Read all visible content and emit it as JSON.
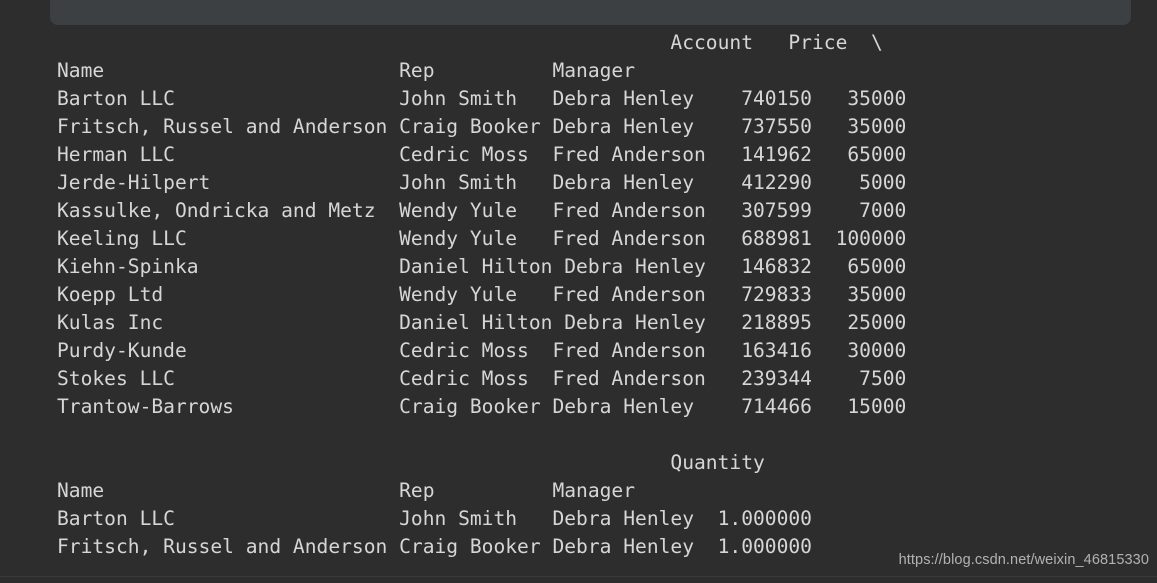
{
  "window": {
    "background_color": "#2d2d2d",
    "cell_background_color": "#3c4043",
    "text_color": "#d6d6d6"
  },
  "watermark": {
    "text": "https://blog.csdn.net/weixin_46815330"
  },
  "output": {
    "type": "pandas-dataframe-text-repr",
    "line_continuation_marker": "\\",
    "blocks": [
      {
        "id": "block-account-price",
        "column_header_line": "                                                    Account   Price  \\",
        "index_header_line": "Name                         Rep          Manager                      ",
        "columns": [
          "Account",
          "Price"
        ],
        "index_names": [
          "Name",
          "Rep",
          "Manager"
        ],
        "rows": [
          {
            "name": "Barton LLC",
            "rep": "John Smith",
            "manager": "Debra Henley",
            "account": "740150",
            "price": "35000"
          },
          {
            "name": "Fritsch, Russel and Anderson",
            "rep": "Craig Booker",
            "manager": "Debra Henley",
            "account": "737550",
            "price": "35000"
          },
          {
            "name": "Herman LLC",
            "rep": "Cedric Moss",
            "manager": "Fred Anderson",
            "account": "141962",
            "price": "65000"
          },
          {
            "name": "Jerde-Hilpert",
            "rep": "John Smith",
            "manager": "Debra Henley",
            "account": "412290",
            "price": "5000"
          },
          {
            "name": "Kassulke, Ondricka and Metz",
            "rep": "Wendy Yule",
            "manager": "Fred Anderson",
            "account": "307599",
            "price": "7000"
          },
          {
            "name": "Keeling LLC",
            "rep": "Wendy Yule",
            "manager": "Fred Anderson",
            "account": "688981",
            "price": "100000"
          },
          {
            "name": "Kiehn-Spinka",
            "rep": "Daniel Hilton",
            "manager": "Debra Henley",
            "account": "146832",
            "price": "65000"
          },
          {
            "name": "Koepp Ltd",
            "rep": "Wendy Yule",
            "manager": "Fred Anderson",
            "account": "729833",
            "price": "35000"
          },
          {
            "name": "Kulas Inc",
            "rep": "Daniel Hilton",
            "manager": "Debra Henley",
            "account": "218895",
            "price": "25000"
          },
          {
            "name": "Purdy-Kunde",
            "rep": "Cedric Moss",
            "manager": "Fred Anderson",
            "account": "163416",
            "price": "30000"
          },
          {
            "name": "Stokes LLC",
            "rep": "Cedric Moss",
            "manager": "Fred Anderson",
            "account": "239344",
            "price": "7500"
          },
          {
            "name": "Trantow-Barrows",
            "rep": "Craig Booker",
            "manager": "Debra Henley",
            "account": "714466",
            "price": "15000"
          }
        ]
      },
      {
        "id": "block-quantity",
        "column_header_line": "                                                    Quantity",
        "index_header_line": "Name                         Rep          Manager             ",
        "columns": [
          "Quantity"
        ],
        "index_names": [
          "Name",
          "Rep",
          "Manager"
        ],
        "rows": [
          {
            "name": "Barton LLC",
            "rep": "John Smith",
            "manager": "Debra Henley",
            "quantity": "1.000000"
          },
          {
            "name": "Fritsch, Russel and Anderson",
            "rep": "Craig Booker",
            "manager": "Debra Henley",
            "quantity": "1.000000"
          }
        ]
      }
    ],
    "rendered_lines": [
      "                                                    Account   Price  \\",
      "Name                         Rep          Manager                      ",
      "Barton LLC                   John Smith   Debra Henley    740150   35000",
      "Fritsch, Russel and Anderson Craig Booker Debra Henley    737550   35000",
      "Herman LLC                   Cedric Moss  Fred Anderson   141962   65000",
      "Jerde-Hilpert                John Smith   Debra Henley    412290    5000",
      "Kassulke, Ondricka and Metz  Wendy Yule   Fred Anderson   307599    7000",
      "Keeling LLC                  Wendy Yule   Fred Anderson   688981  100000",
      "Kiehn-Spinka                 Daniel Hilton Debra Henley   146832   65000",
      "Koepp Ltd                    Wendy Yule   Fred Anderson   729833   35000",
      "Kulas Inc                    Daniel Hilton Debra Henley   218895   25000",
      "Purdy-Kunde                  Cedric Moss  Fred Anderson   163416   30000",
      "Stokes LLC                   Cedric Moss  Fred Anderson   239344    7500",
      "Trantow-Barrows              Craig Booker Debra Henley    714466   15000",
      "",
      "                                                    Quantity",
      "Name                         Rep          Manager             ",
      "Barton LLC                   John Smith   Debra Henley  1.000000",
      "Fritsch, Russel and Anderson Craig Booker Debra Henley  1.000000"
    ]
  }
}
